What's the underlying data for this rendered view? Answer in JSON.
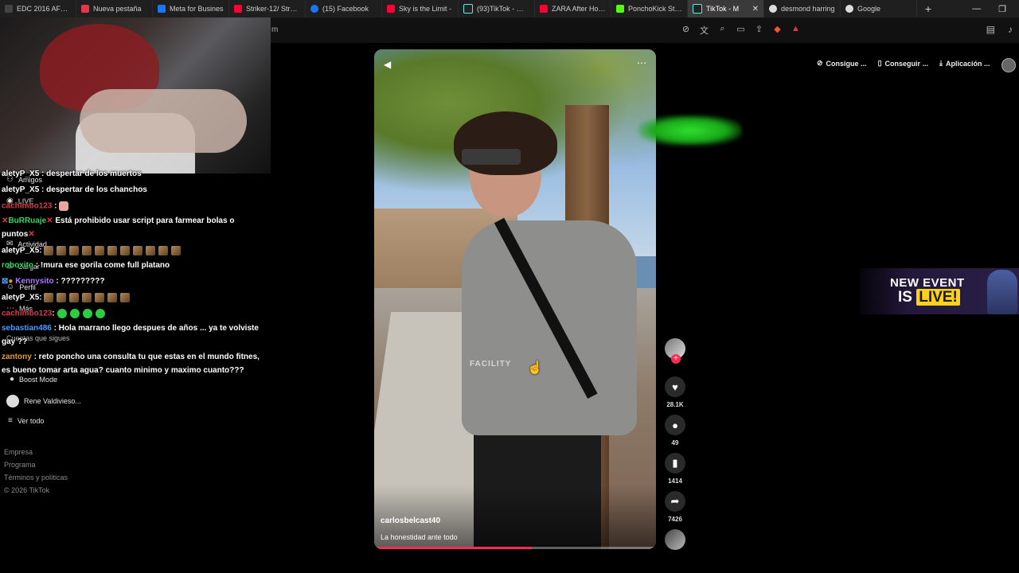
{
  "browser": {
    "tabs": [
      {
        "title": "EDC 2016 AFTER",
        "color": "#444444",
        "active": false
      },
      {
        "title": "Nueva pestaña",
        "color": "#e0374a",
        "active": false
      },
      {
        "title": "Meta for Busines",
        "color": "#1877f2",
        "active": false
      },
      {
        "title": "Striker-12/ Street",
        "color": "#ff0033",
        "active": false
      },
      {
        "title": "(15) Facebook",
        "color": "#1877f2",
        "active": false
      },
      {
        "title": "Sky is the Limit -",
        "color": "#ff0033",
        "active": false
      },
      {
        "title": "(93)TikTok - Mak",
        "color": "#222222",
        "active": false
      },
      {
        "title": "ZARA After Hours",
        "color": "#ff0033",
        "active": false
      },
      {
        "title": "PonchoKick Strea",
        "color": "#53fc18",
        "active": false
      },
      {
        "title": "TikTok - M",
        "color": "#222222",
        "active": true
      },
      {
        "title": "desmond harring",
        "color": "#dddddd",
        "active": false
      },
      {
        "title": "Google",
        "color": "#dddddd",
        "active": false
      }
    ],
    "new_tab": "+",
    "url_fragment": "m"
  },
  "sidebar": {
    "items": [
      {
        "label": "Amigos",
        "icon": "friends-icon"
      },
      {
        "label": "LIVE",
        "icon": "live-icon"
      },
      {
        "label": "Actividad",
        "icon": "activity-icon"
      },
      {
        "label": "Cargar",
        "icon": "upload-icon"
      },
      {
        "label": "Perfil",
        "icon": "profile-icon"
      },
      {
        "label": "Más",
        "icon": "more-icon"
      }
    ],
    "following_title": "Cuentas que sigues",
    "following": [
      {
        "label": "Boost Mode"
      },
      {
        "label": "Rene Valdivieso..."
      }
    ],
    "see_all": "Ver todo",
    "footer": [
      "Empresa",
      "Programa",
      "Términos y políticas",
      "© 2026 TikTok"
    ]
  },
  "chat": [
    {
      "user": "aletyP_X5",
      "msg": ": despertar de los muertos"
    },
    {
      "user": "aletyP_X5",
      "msg": ": despertar de los chanchos"
    },
    {
      "user": "cachimbo123",
      "msg": ":"
    },
    {
      "user": "BuRRuaje",
      "msg": "Está prohibido usar script para farmear bolas o"
    },
    {
      "user": "",
      "msg": "puntos"
    },
    {
      "user": "aletyP_X5",
      "msg": ":"
    },
    {
      "user": "roboxito",
      "msg": ": !mura ese gorila come full platano"
    },
    {
      "user": "Kennysito",
      "msg": ": ?????????"
    },
    {
      "user": "aletyP_X5",
      "msg": ":"
    },
    {
      "user": "cachimbo123",
      "msg": ":"
    },
    {
      "user": "sebastian486",
      "msg": ": Hola marrano llego despues de años ... ya te volviste"
    },
    {
      "user": "",
      "msg": "gay ??"
    },
    {
      "user": "zantony",
      "msg": ": reto poncho una consulta tu que estas en el mundo fitnes,"
    },
    {
      "user": "",
      "msg": "es bueno tomar arta agua? cuanto minimo y maximo cuanto???"
    }
  ],
  "video": {
    "author": "carlosbelcast40",
    "caption": "La honestidad ante todo",
    "shirt_text": "FACILITY",
    "progress": 0.56,
    "likes": "28.1K",
    "comments": "49",
    "saves": "1414",
    "shares": "7426"
  },
  "topright": {
    "buttons": [
      "Consigue ...",
      "Conseguir ...",
      "Aplicación ..."
    ]
  },
  "event_banner": {
    "line1": "NEW EVENT",
    "line2_a": "IS",
    "line2_b": "LIVE!"
  },
  "colors": {
    "accent": "#fe2c55",
    "background": "#000000"
  }
}
